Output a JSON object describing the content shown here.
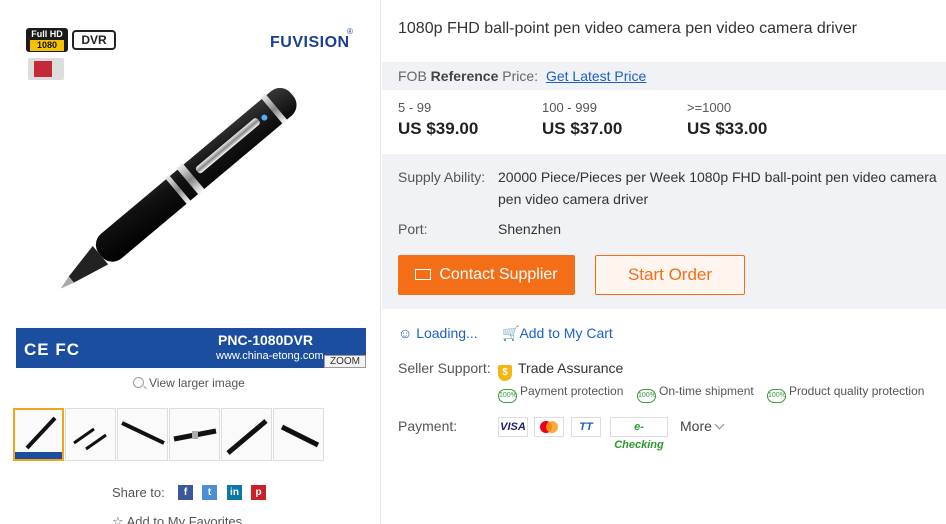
{
  "gallery": {
    "badges": {
      "fhd_top": "Full HD",
      "fhd_bottom": "1080",
      "dvr": "DVR",
      "sd": "micro SD"
    },
    "brand": "FUVISION",
    "brand_mark": "®",
    "banner": {
      "certs": "CE FC",
      "model": "PNC-1080DVR",
      "site": "www.china-etong.com"
    },
    "zoom_label": "ZOOM",
    "view_larger": "View larger image",
    "share_label": "Share to:",
    "favorites_label": "Add to My Favorites"
  },
  "product": {
    "title": "1080p FHD ball-point pen video camera pen video camera driver",
    "fob": {
      "prefix": "FOB",
      "bold": "Reference",
      "suffix": "Price:",
      "link": "Get Latest Price"
    },
    "price_tiers": [
      {
        "range": "5 - 99",
        "price": "US $39.00"
      },
      {
        "range": "100 - 999",
        "price": "US $37.00"
      },
      {
        "range": ">=1000",
        "price": "US $33.00"
      }
    ],
    "supply_label": "Supply Ability:",
    "supply_value": "20000 Piece/Pieces per Week 1080p FHD ball-point pen video camera pen video camera driver",
    "port_label": "Port:",
    "port_value": "Shenzhen",
    "contact_button": "Contact Supplier",
    "order_button": "Start Order",
    "loading_label": "Loading...",
    "cart_label": "Add to My Cart",
    "seller_support_label": "Seller Support:",
    "trade_assurance": "Trade Assurance",
    "guarantees": [
      "Payment protection",
      "On-time shipment",
      "Product quality protection"
    ],
    "guarantee_badge": "100%",
    "payment_label": "Payment:",
    "payment_methods": [
      "VISA",
      "MC",
      "TT",
      "e-Checking"
    ],
    "more_label": "More"
  },
  "colors": {
    "accent": "#f46e18",
    "link": "#1e5fc9",
    "banner": "#1c4ea0",
    "panel": "#f0f2f5"
  }
}
